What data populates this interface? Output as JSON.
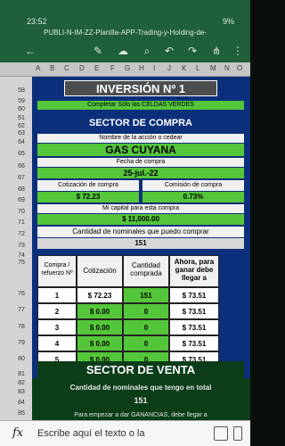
{
  "status_bar": {
    "time": "23:52",
    "battery": "9%"
  },
  "window_title": "PUBLI-N-IM-ZZ-Planilla-APP-Trading-y-Holding-de-",
  "toolbar_icons": [
    "back-arrow-icon",
    "text-format-icon",
    "add-comment-icon",
    "search-icon",
    "undo-icon",
    "redo-icon",
    "share-icon",
    "more-options-icon"
  ],
  "columns": [
    "A",
    "B",
    "C",
    "D",
    "E",
    "F",
    "G",
    "H",
    "I",
    "J",
    "K",
    "L",
    "M",
    "N",
    "O",
    "P"
  ],
  "rows": {
    "r58": "58",
    "r59": "59",
    "r60": "60",
    "r61": "61",
    "r62": "62",
    "r63": "63",
    "r64": "64",
    "r65": "65",
    "r66": "66",
    "r67": "67",
    "r68": "68",
    "r69": "69",
    "r70": "70",
    "r71": "71",
    "r72": "72",
    "r73": "73",
    "r74": "74",
    "r75": "75",
    "r76": "76",
    "r77": "77",
    "r78": "78",
    "r79": "79",
    "r80": "80",
    "r81": "81",
    "r82": "82",
    "r83": "83",
    "r84": "84",
    "r85": "85",
    "r86": "86"
  },
  "sheet": {
    "investment_title": "INVERSIÓN Nº 1",
    "fill_green": "Completar Sólo las CELDAS VERDES",
    "buy_section": "SECTOR DE COMPRA",
    "stock_name_label": "Nombre de la acción o cedear",
    "stock_name": "GAS CUYANA",
    "purchase_date_label": "Fecha de compra",
    "purchase_date": "25-jul.-22",
    "buy_price_label": "Cotización de compra",
    "buy_price": "$ 72.23",
    "buy_commission_label": "Comisión de compra",
    "buy_commission": "0.73%",
    "capital_label": "Mi capital para esta compra",
    "capital": "$ 11,000.00",
    "nominals_label": "Cantidad de nominales que puedo comprar",
    "nominals": "151",
    "table": {
      "headers": [
        "Compra / refuerzo Nº",
        "Cotización",
        "Cantidad comprada",
        "Ahora, para ganar debe llegar a"
      ],
      "rows": [
        [
          "1",
          "$ 72.23",
          "151",
          "$ 73.51"
        ],
        [
          "2",
          "$ 0.00",
          "0",
          "$ 73.51"
        ],
        [
          "3",
          "$ 0.00",
          "0",
          "$ 73.51"
        ],
        [
          "4",
          "$ 0.00",
          "0",
          "$ 73.51"
        ],
        [
          "5",
          "$ 0.00",
          "0",
          "$ 73.51"
        ]
      ]
    },
    "sell_section": "SECTOR DE VENTA",
    "held_nominals_label": "Cantidad de nominales que tengo en total",
    "held_nominals": "151",
    "gain_hint": "Para empezar a dar GANANCIAS, debe llegar a"
  },
  "formula_bar": {
    "fx": "fx",
    "placeholder": "Escribe aquí el texto o la"
  },
  "colors": {
    "app_green": "#1f5f3a",
    "cell_green": "#54c63a",
    "blue_bg": "#0b2f7a"
  }
}
